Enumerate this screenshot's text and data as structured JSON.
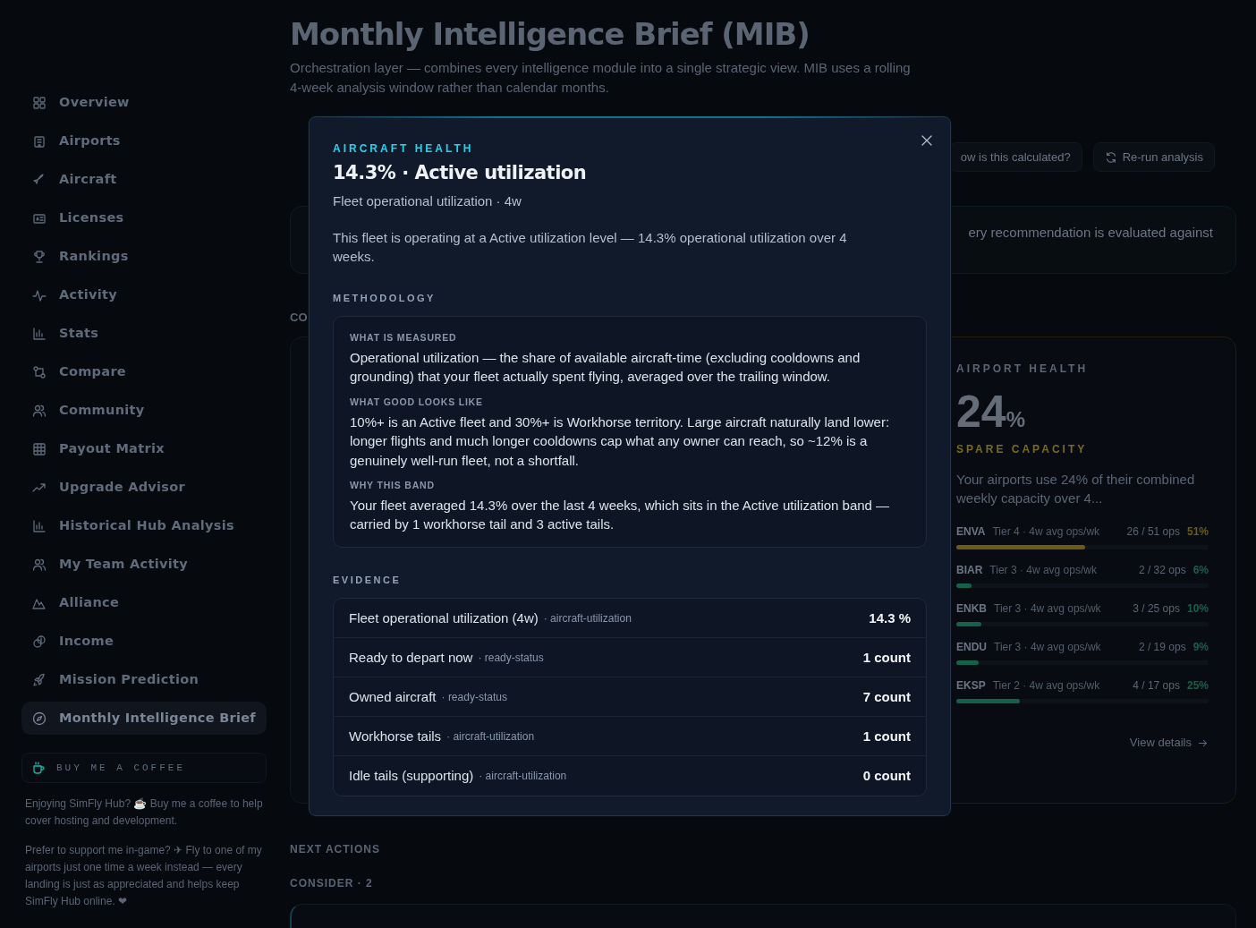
{
  "sidebar": {
    "items": [
      {
        "label": "Overview",
        "selected": false
      },
      {
        "label": "Airports",
        "selected": false
      },
      {
        "label": "Aircraft",
        "selected": false
      },
      {
        "label": "Licenses",
        "selected": false
      },
      {
        "label": "Rankings",
        "selected": false
      },
      {
        "label": "Activity",
        "selected": false
      },
      {
        "label": "Stats",
        "selected": false
      },
      {
        "label": "Compare",
        "selected": false
      },
      {
        "label": "Community",
        "selected": false
      },
      {
        "label": "Payout Matrix",
        "selected": false
      },
      {
        "label": "Upgrade Advisor",
        "selected": false
      },
      {
        "label": "Historical Hub Analysis",
        "selected": false
      },
      {
        "label": "My Team Activity",
        "selected": false
      },
      {
        "label": "Alliance",
        "selected": false
      },
      {
        "label": "Income",
        "selected": false
      },
      {
        "label": "Mission Prediction",
        "selected": false
      },
      {
        "label": "Monthly Intelligence Brief",
        "selected": true
      }
    ],
    "support": {
      "button": "BUY ME A COFFEE",
      "paragraphs": [
        "Enjoying SimFly Hub? ☕ Buy me a coffee to help cover hosting and development.",
        "Prefer to support me in-game? ✈ Fly to one of my airports just one time a week instead — every landing is just as appreciated and helps keep SimFly Hub online. ❤"
      ]
    }
  },
  "header": {
    "title": "Monthly Intelligence Brief (MIB)",
    "description": "Orchestration layer — combines every intelligence module into a single strategic view. MIB uses a rolling 4-week analysis window rather than calendar months."
  },
  "toolbar": {
    "buttons": [
      "ow is this calculated?",
      "Re-run analysis"
    ]
  },
  "notice": "ery recommendation is evaluated against",
  "section_label": "CO",
  "airport_health": {
    "eyebrow": "AIRPORT HEALTH",
    "value": "24",
    "unit": "%",
    "status": "SPARE CAPACITY",
    "description": "Your airports use 24% of their combined weekly capacity over 4...",
    "rows": [
      {
        "code": "ENVA",
        "detail": "Tier 4 · 4w avg ops/wk",
        "ops": "26 / 51 ops",
        "percent": "51%",
        "level": 0.51,
        "color": "#6b5a14"
      },
      {
        "code": "BIAR",
        "detail": "Tier 3 · 4w avg ops/wk",
        "ops": "2 / 32 ops",
        "percent": "6%",
        "level": 0.06,
        "color": "#136148"
      },
      {
        "code": "ENKB",
        "detail": "Tier 3 · 4w avg ops/wk",
        "ops": "3 / 25 ops",
        "percent": "10%",
        "level": 0.1,
        "color": "#136148"
      },
      {
        "code": "ENDU",
        "detail": "Tier 3 · 4w avg ops/wk",
        "ops": "2 / 19 ops",
        "percent": "9%",
        "level": 0.09,
        "color": "#136148"
      },
      {
        "code": "EKSP",
        "detail": "Tier 2 · 4w avg ops/wk",
        "ops": "4 / 17 ops",
        "percent": "25%",
        "level": 0.25,
        "color": "#136148"
      }
    ],
    "link": "View details"
  },
  "next_actions": {
    "title": "NEXT ACTIONS",
    "group": "CONSIDER · 2"
  },
  "modal": {
    "eyebrow": "AIRCRAFT HEALTH",
    "title": "14.3% · Active utilization",
    "subtitle": "Fleet operational utilization · 4w",
    "description": "This fleet is operating at a Active utilization level — 14.3% operational utilization over 4 weeks.",
    "methodology_label": "METHODOLOGY",
    "methodology": [
      {
        "label": "WHAT IS MEASURED",
        "text": "Operational utilization — the share of available aircraft-time (excluding cooldowns and grounding) that your fleet actually spent flying, averaged over the trailing window."
      },
      {
        "label": "WHAT GOOD LOOKS LIKE",
        "text": "10%+ is an Active fleet and 30%+ is Workhorse territory. Large aircraft naturally land lower: longer flights and much longer cooldowns cap what any owner can reach, so ~12% is a genuinely well-run fleet, not a shortfall."
      },
      {
        "label": "WHY THIS BAND",
        "text": "Your fleet averaged 14.3% over the last 4 weeks, which sits in the Active utilization band — carried by 1 workhorse tail and 3 active tails."
      }
    ],
    "evidence_label": "EVIDENCE",
    "evidence": [
      {
        "label": "Fleet operational utilization (4w)",
        "source": "· aircraft-utilization",
        "value": "14.3 %"
      },
      {
        "label": "Ready to depart now",
        "source": "· ready-status",
        "value": "1 count"
      },
      {
        "label": "Owned aircraft",
        "source": "· ready-status",
        "value": "7 count"
      },
      {
        "label": "Workhorse tails",
        "source": "· aircraft-utilization",
        "value": "1 count"
      },
      {
        "label": "Idle tails (supporting)",
        "source": "· aircraft-utilization",
        "value": "0 count"
      }
    ]
  }
}
